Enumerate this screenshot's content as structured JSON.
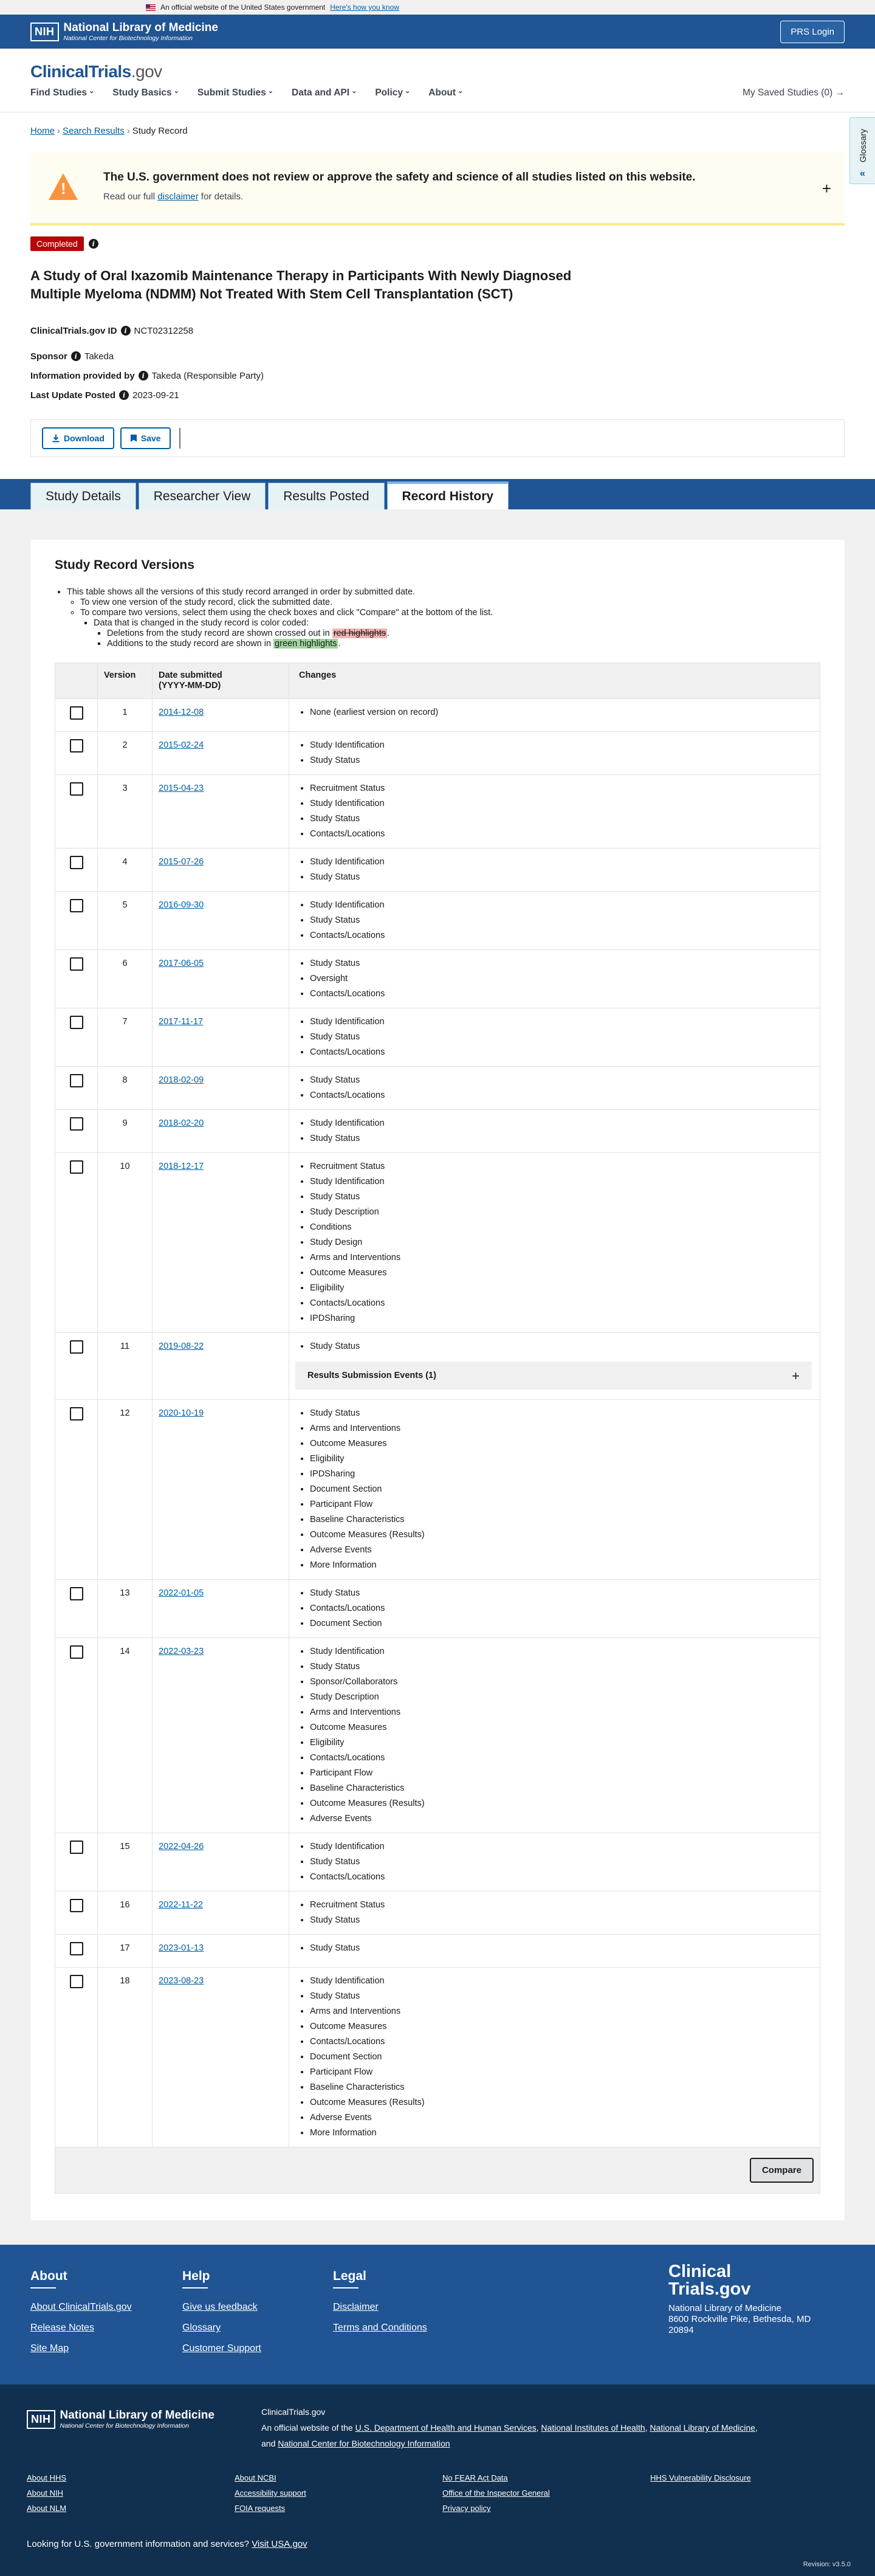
{
  "gov_banner": {
    "text": "An official website of the United States government",
    "link": "Here's how you know"
  },
  "nlm": {
    "logo_box": "NIH",
    "title": "National Library of Medicine",
    "subtitle": "National Center for Biotechnology Information",
    "prs_login": "PRS Login"
  },
  "header": {
    "logo_main": "ClinicalTrials",
    "logo_suffix": ".gov",
    "nav": [
      "Find Studies",
      "Study Basics",
      "Submit Studies",
      "Data and API",
      "Policy",
      "About"
    ],
    "saved": "My Saved Studies (0) →"
  },
  "breadcrumb": {
    "home": "Home",
    "search": "Search Results",
    "current": "Study Record"
  },
  "glossary": {
    "label": "Glossary",
    "icon": "«"
  },
  "alert": {
    "title": "The U.S. government does not review or approve the safety and science of all studies listed on this website.",
    "body_prefix": "Read our full",
    "body_link": "disclaimer",
    "body_suffix": "for details.",
    "plus": "+"
  },
  "study": {
    "status": "Completed",
    "title": "A Study of Oral Ixazomib Maintenance Therapy in Participants With Newly Diagnosed Multiple Myeloma (NDMM) Not Treated With Stem Cell Transplantation (SCT)",
    "id_label": "ClinicalTrials.gov ID",
    "id_value": "NCT02312258",
    "sponsor_label": "Sponsor",
    "sponsor_value": "Takeda",
    "provided_label": "Information provided by",
    "provided_value": "Takeda (Responsible Party)",
    "updated_label": "Last Update Posted",
    "updated_value": "2023-09-21"
  },
  "actions": {
    "download": "Download",
    "save": "Save"
  },
  "tabs": [
    "Study Details",
    "Researcher View",
    "Results Posted",
    "Record History"
  ],
  "versions_section": {
    "title": "Study Record Versions",
    "bullets": [
      "This table shows all the versions of this study record arranged in order by submitted date.",
      "To view one version of the study record, click the submitted date.",
      "To compare two versions, select them using the check boxes and click \"Compare\" at the bottom of the list.",
      "Data that is changed in the study record is color coded:"
    ],
    "deletions_prefix": "Deletions from the study record are shown crossed out in",
    "deletions_hl": "red highlights",
    "additions_prefix": "Additions to the study record are shown in",
    "additions_hl": "green highlights",
    "col_version": "Version",
    "col_date_1": "Date submitted",
    "col_date_2": "(YYYY-MM-DD)",
    "col_changes": "Changes",
    "results_events": "Results Submission Events (1)",
    "compare": "Compare"
  },
  "versions": [
    {
      "v": "1",
      "date": "2014-12-08",
      "changes": [
        "None (earliest version on record)"
      ]
    },
    {
      "v": "2",
      "date": "2015-02-24",
      "changes": [
        "Study Identification",
        "Study Status"
      ]
    },
    {
      "v": "3",
      "date": "2015-04-23",
      "changes": [
        "Recruitment Status",
        "Study Identification",
        "Study Status",
        "Contacts/Locations"
      ]
    },
    {
      "v": "4",
      "date": "2015-07-26",
      "changes": [
        "Study Identification",
        "Study Status"
      ]
    },
    {
      "v": "5",
      "date": "2016-09-30",
      "changes": [
        "Study Identification",
        "Study Status",
        "Contacts/Locations"
      ]
    },
    {
      "v": "6",
      "date": "2017-06-05",
      "changes": [
        "Study Status",
        "Oversight",
        "Contacts/Locations"
      ]
    },
    {
      "v": "7",
      "date": "2017-11-17",
      "changes": [
        "Study Identification",
        "Study Status",
        "Contacts/Locations"
      ]
    },
    {
      "v": "8",
      "date": "2018-02-09",
      "changes": [
        "Study Status",
        "Contacts/Locations"
      ]
    },
    {
      "v": "9",
      "date": "2018-02-20",
      "changes": [
        "Study Identification",
        "Study Status"
      ]
    },
    {
      "v": "10",
      "date": "2018-12-17",
      "changes": [
        "Recruitment Status",
        "Study Identification",
        "Study Status",
        "Study Description",
        "Conditions",
        "Study Design",
        "Arms and Interventions",
        "Outcome Measures",
        "Eligibility",
        "Contacts/Locations",
        "IPDSharing"
      ]
    },
    {
      "v": "11",
      "date": "2019-08-22",
      "changes": [
        "Study Status"
      ],
      "results_events": true
    },
    {
      "v": "12",
      "date": "2020-10-19",
      "changes": [
        "Study Status",
        "Arms and Interventions",
        "Outcome Measures",
        "Eligibility",
        "IPDSharing",
        "Document Section",
        "Participant Flow",
        "Baseline Characteristics",
        "Outcome Measures (Results)",
        "Adverse Events",
        "More Information"
      ]
    },
    {
      "v": "13",
      "date": "2022-01-05",
      "changes": [
        "Study Status",
        "Contacts/Locations",
        "Document Section"
      ]
    },
    {
      "v": "14",
      "date": "2022-03-23",
      "changes": [
        "Study Identification",
        "Study Status",
        "Sponsor/Collaborators",
        "Study Description",
        "Arms and Interventions",
        "Outcome Measures",
        "Eligibility",
        "Contacts/Locations",
        "Participant Flow",
        "Baseline Characteristics",
        "Outcome Measures (Results)",
        "Adverse Events"
      ]
    },
    {
      "v": "15",
      "date": "2022-04-26",
      "changes": [
        "Study Identification",
        "Study Status",
        "Contacts/Locations"
      ]
    },
    {
      "v": "16",
      "date": "2022-11-22",
      "changes": [
        "Recruitment Status",
        "Study Status"
      ]
    },
    {
      "v": "17",
      "date": "2023-01-13",
      "changes": [
        "Study Status"
      ]
    },
    {
      "v": "18",
      "date": "2023-08-23",
      "changes": [
        "Study Identification",
        "Study Status",
        "Arms and Interventions",
        "Outcome Measures",
        "Contacts/Locations",
        "Document Section",
        "Participant Flow",
        "Baseline Characteristics",
        "Outcome Measures (Results)",
        "Adverse Events",
        "More Information"
      ]
    }
  ],
  "footer": {
    "about_title": "About",
    "about_links": [
      "About ClinicalTrials.gov",
      "Release Notes",
      "Site Map"
    ],
    "help_title": "Help",
    "help_links": [
      "Give us feedback",
      "Glossary",
      "Customer Support"
    ],
    "legal_title": "Legal",
    "legal_links": [
      "Disclaimer",
      "Terms and Conditions"
    ],
    "contact_logo_1": "Clinical",
    "contact_logo_2": "Trials.gov",
    "contact_org": "National Library of Medicine",
    "contact_addr1": "8600 Rockville Pike, Bethesda, MD",
    "contact_addr2": "20894",
    "site_name": "ClinicalTrials.gov",
    "official_prefix": "An official website of the",
    "official_links": [
      "U.S. Department of Health and Human Services",
      "National Institutes of Health",
      "National Library of Medicine"
    ],
    "official_and": "and",
    "official_last": "National Center for Biotechnology Information",
    "bottom_links": [
      "About HHS",
      "About NCBI",
      "No FEAR Act Data",
      "HHS Vulnerability Disclosure",
      "About NIH",
      "Accessibility support",
      "Office of the Inspector General",
      "",
      "About NLM",
      "FOIA requests",
      "Privacy policy",
      ""
    ],
    "usa_prefix": "Looking for U.S. government information and services?",
    "usa_link": "Visit USA.gov",
    "version": "Revision: v3.5.0"
  },
  "colors": {
    "brand_blue": "#205493",
    "link": "#005ea2",
    "completed_red": "#b50909",
    "footer_dark": "#112f4e"
  }
}
